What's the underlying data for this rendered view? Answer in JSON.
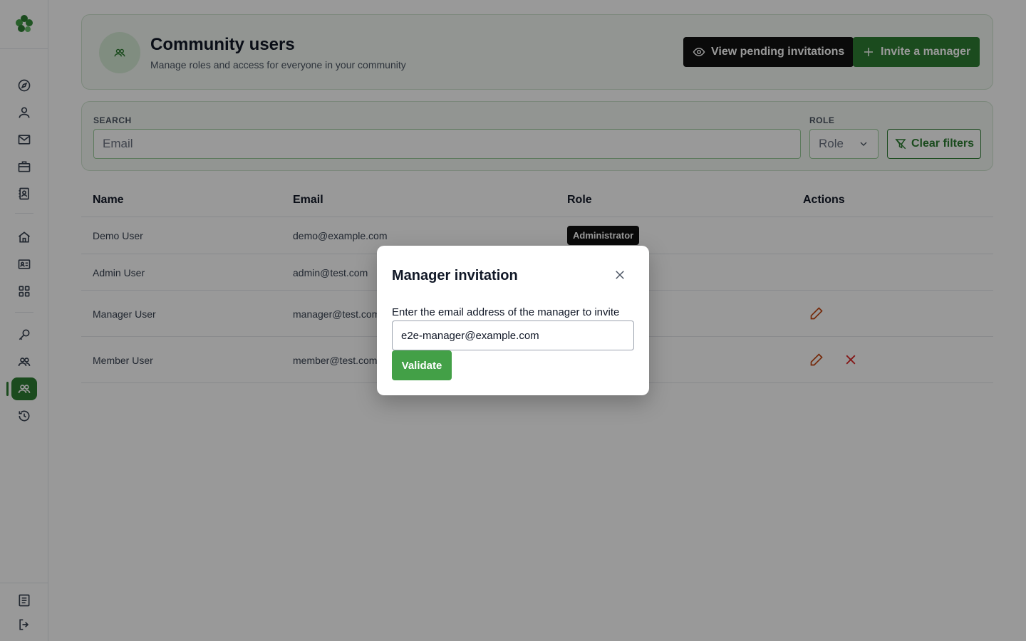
{
  "sidebar": {
    "logo": "clover-logo",
    "items": [
      {
        "icon": "compass-icon"
      },
      {
        "icon": "user-icon"
      },
      {
        "icon": "mail-icon"
      },
      {
        "icon": "briefcase-icon"
      },
      {
        "icon": "contact-book-icon"
      },
      {
        "icon": "home-icon"
      },
      {
        "icon": "id-card-icon"
      },
      {
        "icon": "grid-icon"
      },
      {
        "icon": "key-icon"
      },
      {
        "icon": "users-icon"
      },
      {
        "icon": "community-users-icon",
        "active": true
      },
      {
        "icon": "history-icon"
      }
    ],
    "bottom": [
      {
        "icon": "document-icon"
      },
      {
        "icon": "logout-icon"
      }
    ]
  },
  "header": {
    "title": "Community users",
    "subtitle": "Manage roles and access for everyone in your community",
    "view_pending_label": "View pending invitations",
    "invite_label": "Invite a manager"
  },
  "filters": {
    "search_label": "SEARCH",
    "search_placeholder": "Email",
    "role_label": "ROLE",
    "role_value": "Role",
    "clear_label": "Clear filters"
  },
  "table": {
    "columns": [
      "Name",
      "Email",
      "Role",
      "Actions"
    ],
    "rows": [
      {
        "name": "Demo User",
        "email": "demo@example.com",
        "role": "Administrator"
      },
      {
        "name": "Admin User",
        "email": "admin@test.com",
        "role": ""
      },
      {
        "name": "Manager User",
        "email": "manager@test.com",
        "role": ""
      },
      {
        "name": "Member User",
        "email": "member@test.com",
        "role": ""
      }
    ]
  },
  "modal": {
    "title": "Manager invitation",
    "label": "Enter the email address of the manager to invite",
    "input_value": "e2e-manager@example.com",
    "validate_label": "Validate"
  },
  "colors": {
    "accent": "#2e7d32",
    "danger": "#dc2626",
    "edit": "#c2410c"
  }
}
